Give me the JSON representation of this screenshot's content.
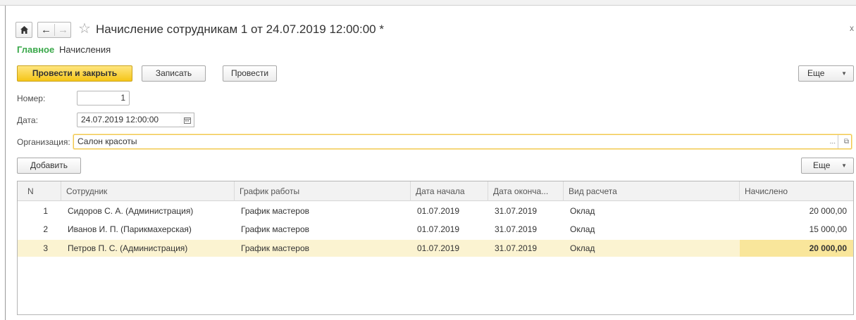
{
  "window": {
    "title": "Начисление сотрудникам 1 от 24.07.2019 12:00:00 *",
    "close_glyph": "x"
  },
  "tabs": [
    {
      "label": "Главное",
      "active": true
    },
    {
      "label": "Начисления",
      "active": false
    }
  ],
  "toolbar": {
    "post_close": "Провести и закрыть",
    "write": "Записать",
    "post": "Провести",
    "more": "Еще"
  },
  "form": {
    "number_label": "Номер:",
    "number_value": "1",
    "date_label": "Дата:",
    "date_value": "24.07.2019 12:00:00",
    "org_label": "Организация:",
    "org_value": "Салон красоты",
    "org_select": "...",
    "org_open": "⧉"
  },
  "table_toolbar": {
    "add": "Добавить",
    "more": "Еще"
  },
  "table": {
    "headers": [
      "N",
      "Сотрудник",
      "График работы",
      "Дата начала",
      "Дата оконча...",
      "Вид расчета",
      "Начислено"
    ],
    "rows": [
      {
        "n": "1",
        "employee": "Сидоров С. А. (Администрация)",
        "schedule": "График мастеров",
        "start": "01.07.2019",
        "end": "31.07.2019",
        "calc": "Оклад",
        "amount": "20 000,00"
      },
      {
        "n": "2",
        "employee": "Иванов И. П. (Парикмахерская)",
        "schedule": "График мастеров",
        "start": "01.07.2019",
        "end": "31.07.2019",
        "calc": "Оклад",
        "amount": "15 000,00"
      },
      {
        "n": "3",
        "employee": "Петров П. С. (Администрация)",
        "schedule": "График мастеров",
        "start": "01.07.2019",
        "end": "31.07.2019",
        "calc": "Оклад",
        "amount": "20 000,00"
      }
    ],
    "selected_row": 3
  },
  "colors": {
    "accent_green": "#3aa84a",
    "primary_button": "#f5c518",
    "selected_row": "#fbf3d1",
    "selected_cell": "#f9e69b"
  },
  "icons": [
    "home-icon",
    "back-arrow-icon",
    "forward-arrow-icon",
    "favorite-star-icon",
    "calendar-icon",
    "dropdown-arrow-icon"
  ]
}
